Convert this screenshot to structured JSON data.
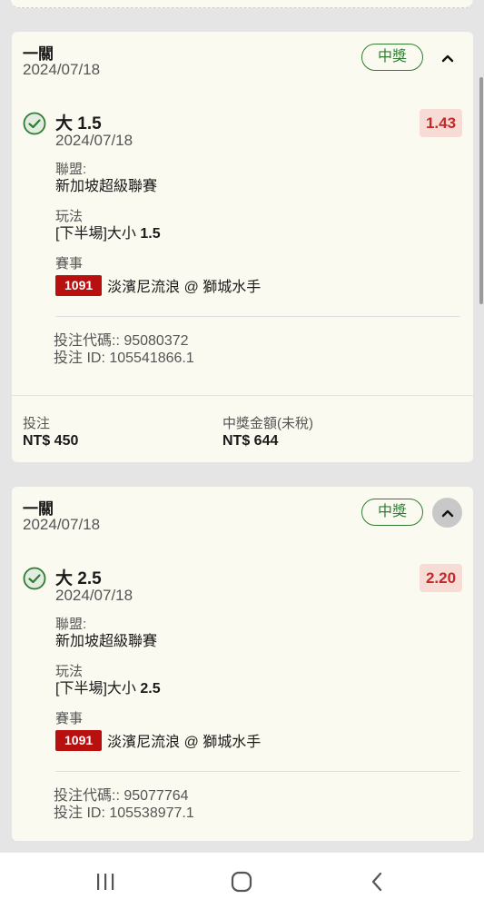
{
  "bets": [
    {
      "type": "一關",
      "date": "2024/07/18",
      "status": "中獎",
      "selection": {
        "name": "大 1.5",
        "date": "2024/07/18",
        "odds": "1.43",
        "league_label": "聯盟:",
        "league": "新加坡超級聯賽",
        "market_label": "玩法",
        "market_prefix": "[下半場]大小 ",
        "market_line": "1.5",
        "event_label": "賽事",
        "match_no": "1091",
        "match": "淡濱尼流浪 @ 獅城水手"
      },
      "bet_code": "投注代碼:: 95080372",
      "bet_id": "投注 ID: 105541866.1",
      "stake_label": "投注",
      "stake": "NT$ 450",
      "payout_label": "中獎金額(未稅)",
      "payout": "NT$ 644"
    },
    {
      "type": "一關",
      "date": "2024/07/18",
      "status": "中獎",
      "selection": {
        "name": "大 2.5",
        "date": "2024/07/18",
        "odds": "2.20",
        "league_label": "聯盟:",
        "league": "新加坡超級聯賽",
        "market_label": "玩法",
        "market_prefix": "[下半場]大小 ",
        "market_line": "2.5",
        "event_label": "賽事",
        "match_no": "1091",
        "match": "淡濱尼流浪 @ 獅城水手"
      },
      "bet_code": "投注代碼:: 95077764",
      "bet_id": "投注 ID: 105538977.1"
    }
  ],
  "icons": {
    "check": "check-circle-icon",
    "collapse": "chevron-up-icon",
    "nav_recent": "recent-apps-icon",
    "nav_home": "home-icon",
    "nav_back": "back-icon"
  },
  "colors": {
    "card_bg": "#fbfaf0",
    "win_green": "#2e7d32",
    "odds_red": "#c62828",
    "match_badge": "#b80f0f"
  }
}
